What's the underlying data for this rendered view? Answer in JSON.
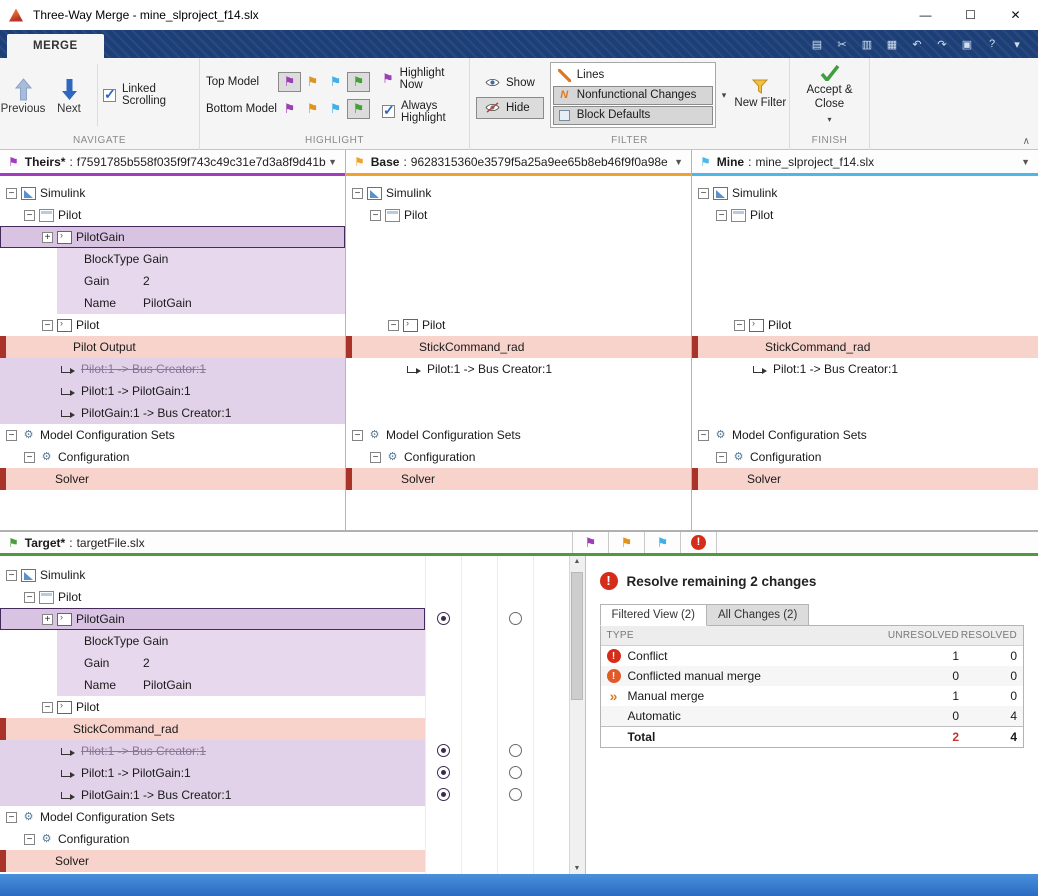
{
  "window": {
    "title": "Three-Way Merge - mine_slproject_f14.slx",
    "controls": {
      "minimize": "—",
      "maximize": "☐",
      "close": "✕"
    }
  },
  "tabs": {
    "merge": "MERGE"
  },
  "quick_access": [
    {
      "name": "save",
      "glyph": "▤"
    },
    {
      "name": "cut",
      "glyph": "✂"
    },
    {
      "name": "copy",
      "glyph": "▥"
    },
    {
      "name": "paste",
      "glyph": "▦"
    },
    {
      "name": "undo",
      "glyph": "↶"
    },
    {
      "name": "redo",
      "glyph": "↷"
    },
    {
      "name": "dock",
      "glyph": "▣"
    },
    {
      "name": "help",
      "glyph": "?"
    },
    {
      "name": "more",
      "glyph": "▾"
    }
  ],
  "ribbon": {
    "navigate": {
      "label": "NAVIGATE",
      "previous": "Previous",
      "next": "Next",
      "linked_scrolling": "Linked Scrolling"
    },
    "highlight": {
      "label": "HIGHLIGHT",
      "top_model": "Top Model",
      "bottom_model": "Bottom Model",
      "highlight_now": "Highlight Now",
      "always_highlight": "Always Highlight",
      "top_flags": [
        {
          "id": "theirs",
          "hex": "#9b3fb5",
          "pressed": true
        },
        {
          "id": "base",
          "hex": "#e0941e",
          "pressed": false
        },
        {
          "id": "mine",
          "hex": "#3fb0e8",
          "pressed": false
        },
        {
          "id": "target",
          "hex": "#46a038",
          "pressed": true
        }
      ],
      "bottom_flags": [
        {
          "id": "theirs",
          "hex": "#9b3fb5",
          "pressed": false
        },
        {
          "id": "base",
          "hex": "#e0941e",
          "pressed": false
        },
        {
          "id": "mine",
          "hex": "#3fb0e8",
          "pressed": false
        },
        {
          "id": "target",
          "hex": "#46a038",
          "pressed": true
        }
      ]
    },
    "filter": {
      "label": "FILTER",
      "show": "Show",
      "hide": "Hide",
      "items": [
        {
          "label": "Lines",
          "icon": "lines",
          "selected": false
        },
        {
          "label": "Nonfunctional Changes",
          "icon": "nonfunctional",
          "selected": true
        },
        {
          "label": "Block Defaults",
          "icon": "block-defaults",
          "selected": true
        }
      ],
      "new_filter": "New Filter"
    },
    "finish": {
      "label": "FINISH",
      "accept_close": "Accept & Close"
    }
  },
  "panels": [
    {
      "id": "theirs",
      "title": "Theirs*",
      "sep": ":",
      "value": "f7591785b558f035f9f743c49c31e7d3a8f9d41b",
      "accent": "#a23bbf"
    },
    {
      "id": "base",
      "title": "Base",
      "sep": ":",
      "value": "9628315360e3579f5a25a9ee65b8eb46f9f0a98e",
      "accent": "#f0a22e"
    },
    {
      "id": "mine",
      "title": "Mine",
      "sep": ":",
      "value": "mine_slproject_f14.slx",
      "accent": "#4cb8e8"
    }
  ],
  "target_panel": {
    "title": "Target*",
    "sep": ":",
    "value": "targetFile.slx",
    "accent": "#4e9a3c",
    "columns": [
      {
        "id": "theirs",
        "type": "flag",
        "hex": "#9b3fb5"
      },
      {
        "id": "base",
        "type": "flag",
        "hex": "#e0941e"
      },
      {
        "id": "mine",
        "type": "flag",
        "hex": "#3fb0e8"
      },
      {
        "id": "conflict",
        "type": "error"
      }
    ],
    "radios": [
      {
        "row": 2,
        "col": 0,
        "state": "selected"
      },
      {
        "row": 2,
        "col": 2,
        "state": "empty"
      },
      {
        "row": 8,
        "col": 0,
        "state": "selected"
      },
      {
        "row": 8,
        "col": 2,
        "state": "empty"
      },
      {
        "row": 9,
        "col": 0,
        "state": "selected"
      },
      {
        "row": 9,
        "col": 2,
        "state": "empty"
      },
      {
        "row": 10,
        "col": 0,
        "state": "selected"
      },
      {
        "row": 10,
        "col": 2,
        "state": "empty"
      }
    ]
  },
  "trees": {
    "theirs": [
      {
        "label": "Simulink",
        "indent": 0,
        "expand": "minus",
        "icon": "simulink"
      },
      {
        "label": "Pilot",
        "indent": 1,
        "expand": "minus",
        "icon": "subsystem"
      },
      {
        "label": "PilotGain",
        "indent": 2,
        "expand": "plus",
        "icon": "block",
        "bg": "selected"
      },
      {
        "kind": "prop",
        "key": "BlockType",
        "value": "Gain"
      },
      {
        "kind": "prop",
        "key": "Gain",
        "value": "2"
      },
      {
        "kind": "prop",
        "key": "Name",
        "value": "PilotGain"
      },
      {
        "label": "Pilot",
        "indent": 2,
        "expand": "minus",
        "icon": "block"
      },
      {
        "label": "Pilot Output",
        "indent": 3,
        "bg": "pink",
        "redbar": true
      },
      {
        "label": "Pilot:1 -> Bus Creator:1",
        "indent": 3,
        "icon": "line",
        "bg": "purple",
        "strike": true
      },
      {
        "label": "Pilot:1 -> PilotGain:1",
        "indent": 3,
        "icon": "line",
        "bg": "purple"
      },
      {
        "label": "PilotGain:1 -> Bus Creator:1",
        "indent": 3,
        "icon": "line",
        "bg": "purple"
      },
      {
        "label": "Model Configuration Sets",
        "indent": 0,
        "expand": "minus",
        "icon": "configset"
      },
      {
        "label": "Configuration",
        "indent": 1,
        "expand": "minus",
        "icon": "config"
      },
      {
        "label": "Solver",
        "indent": 2,
        "bg": "pink",
        "redbar": true
      }
    ],
    "base": [
      {
        "label": "Simulink",
        "indent": 0,
        "expand": "minus",
        "icon": "simulink"
      },
      {
        "label": "Pilot",
        "indent": 1,
        "expand": "minus",
        "icon": "subsystem"
      },
      {
        "kind": "spacer"
      },
      {
        "kind": "spacer"
      },
      {
        "kind": "spacer"
      },
      {
        "kind": "spacer"
      },
      {
        "label": "Pilot",
        "indent": 2,
        "expand": "minus",
        "icon": "block"
      },
      {
        "label": "StickCommand_rad",
        "indent": 3,
        "bg": "pink",
        "redbar": true
      },
      {
        "label": "Pilot:1 -> Bus Creator:1",
        "indent": 3,
        "icon": "line"
      },
      {
        "kind": "spacer"
      },
      {
        "kind": "spacer"
      },
      {
        "label": "Model Configuration Sets",
        "indent": 0,
        "expand": "minus",
        "icon": "configset"
      },
      {
        "label": "Configuration",
        "indent": 1,
        "expand": "minus",
        "icon": "config"
      },
      {
        "label": "Solver",
        "indent": 2,
        "bg": "pink",
        "redbar": true
      }
    ],
    "mine": [
      {
        "label": "Simulink",
        "indent": 0,
        "expand": "minus",
        "icon": "simulink"
      },
      {
        "label": "Pilot",
        "indent": 1,
        "expand": "minus",
        "icon": "subsystem"
      },
      {
        "kind": "spacer"
      },
      {
        "kind": "spacer"
      },
      {
        "kind": "spacer"
      },
      {
        "kind": "spacer"
      },
      {
        "label": "Pilot",
        "indent": 2,
        "expand": "minus",
        "icon": "block"
      },
      {
        "label": "StickCommand_rad",
        "indent": 3,
        "bg": "pink",
        "redbar": true
      },
      {
        "label": "Pilot:1 -> Bus Creator:1",
        "indent": 3,
        "icon": "line"
      },
      {
        "kind": "spacer"
      },
      {
        "kind": "spacer"
      },
      {
        "label": "Model Configuration Sets",
        "indent": 0,
        "expand": "minus",
        "icon": "configset"
      },
      {
        "label": "Configuration",
        "indent": 1,
        "expand": "minus",
        "icon": "config"
      },
      {
        "label": "Solver",
        "indent": 2,
        "bg": "pink",
        "redbar": true
      }
    ],
    "target": [
      {
        "label": "Simulink",
        "indent": 0,
        "expand": "minus",
        "icon": "simulink"
      },
      {
        "label": "Pilot",
        "indent": 1,
        "expand": "minus",
        "icon": "subsystem"
      },
      {
        "label": "PilotGain",
        "indent": 2,
        "expand": "plus",
        "icon": "block",
        "bg": "selected"
      },
      {
        "kind": "prop",
        "key": "BlockType",
        "value": "Gain"
      },
      {
        "kind": "prop",
        "key": "Gain",
        "value": "2"
      },
      {
        "kind": "prop",
        "key": "Name",
        "value": "PilotGain"
      },
      {
        "label": "Pilot",
        "indent": 2,
        "expand": "minus",
        "icon": "block"
      },
      {
        "label": "StickCommand_rad",
        "indent": 3,
        "bg": "pink",
        "redbar": true
      },
      {
        "label": "Pilot:1 -> Bus Creator:1",
        "indent": 3,
        "icon": "line",
        "bg": "purple",
        "strike": true
      },
      {
        "label": "Pilot:1 -> PilotGain:1",
        "indent": 3,
        "icon": "line",
        "bg": "purple"
      },
      {
        "label": "PilotGain:1 -> Bus Creator:1",
        "indent": 3,
        "icon": "line",
        "bg": "purple"
      },
      {
        "label": "Model Configuration Sets",
        "indent": 0,
        "expand": "minus",
        "icon": "configset"
      },
      {
        "label": "Configuration",
        "indent": 1,
        "expand": "minus",
        "icon": "config"
      },
      {
        "label": "Solver",
        "indent": 2,
        "bg": "pink",
        "redbar": true
      }
    ]
  },
  "summary": {
    "title": "Resolve remaining 2 changes",
    "tabs": [
      {
        "label": "Filtered View (2)",
        "active": true
      },
      {
        "label": "All Changes (2)",
        "active": false
      }
    ],
    "columns": [
      "TYPE",
      "UNRESOLVED",
      "RESOLVED"
    ],
    "rows": [
      {
        "type": "Conflict",
        "icon": "conflict",
        "unresolved": "1",
        "resolved": "0"
      },
      {
        "type": "Conflicted manual merge",
        "icon": "conflicted-manual-merge",
        "unresolved": "0",
        "resolved": "0"
      },
      {
        "type": "Manual merge",
        "icon": "manual-merge",
        "unresolved": "1",
        "resolved": "0"
      },
      {
        "type": "Automatic",
        "icon": "",
        "unresolved": "0",
        "resolved": "4"
      },
      {
        "type": "Total",
        "icon": "",
        "bold": true,
        "unresolved": "2",
        "resolved": "4",
        "highlight_unresolved": true
      }
    ]
  }
}
